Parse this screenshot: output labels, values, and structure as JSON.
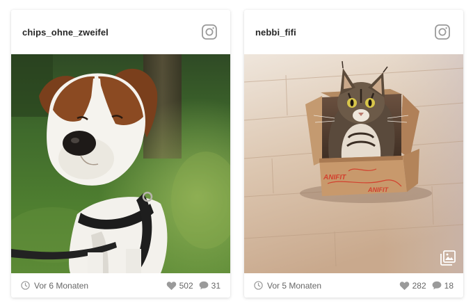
{
  "posts": [
    {
      "username": "chips_ohne_zweifel",
      "time": "Vor 6 Monaten",
      "likes": "502",
      "comments": "31",
      "photo_subject": "dog"
    },
    {
      "username": "nebbi_fifi",
      "time": "Vor 5 Monaten",
      "likes": "282",
      "comments": "18",
      "photo_subject": "cat-in-box",
      "box_print": "ANIFIT"
    }
  ],
  "icons": {
    "header": "instagram-icon",
    "footer_time": "clock-icon",
    "footer_likes": "heart-icon",
    "footer_comments": "comment-icon",
    "overlay": "gallery-icon"
  },
  "colors": {
    "card_bg": "#ffffff",
    "text_muted": "#666666",
    "icon_gray": "#9a9a9a",
    "username": "#262626"
  }
}
